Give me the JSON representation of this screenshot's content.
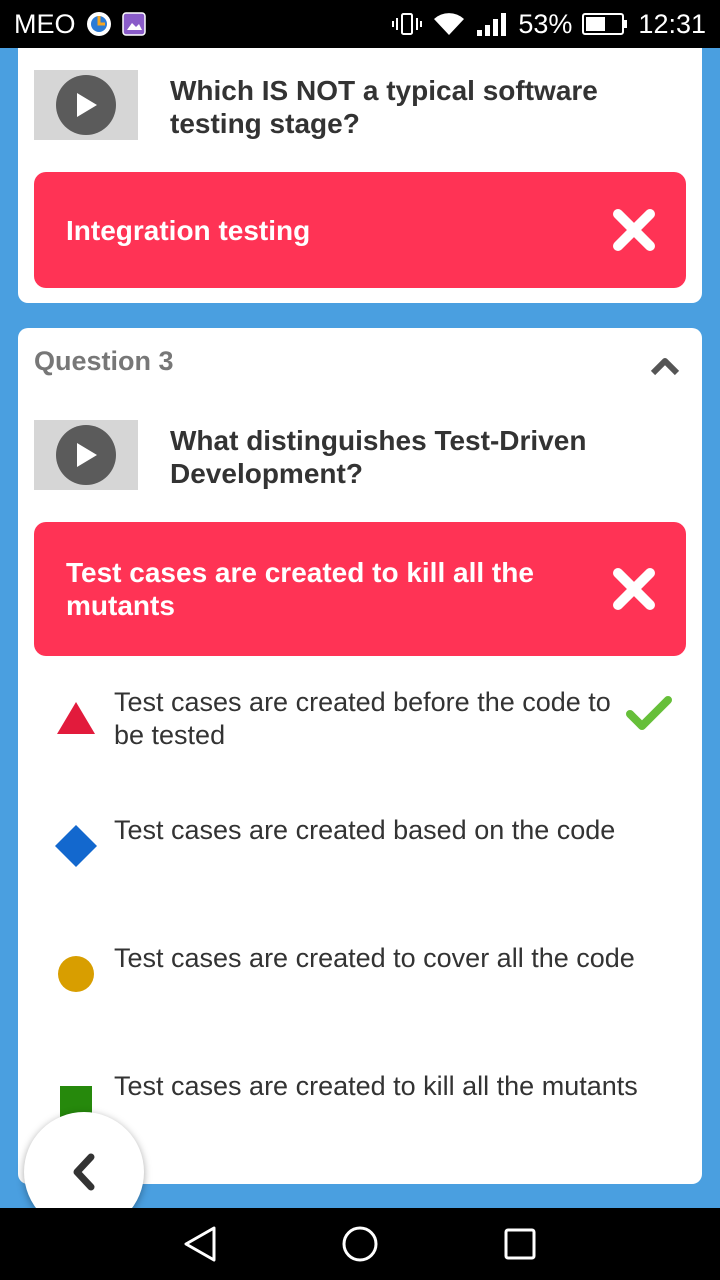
{
  "status_bar": {
    "carrier": "MEO",
    "battery": "53%",
    "time": "12:31"
  },
  "card_previous": {
    "question": "Which IS NOT a typical software testing stage?",
    "selected_answer": "Integration testing",
    "selected_correct": false
  },
  "card_current": {
    "header": "Question 3",
    "question": "What distinguishes Test-Driven Development?",
    "selected_answer": "Test cases are created to kill all the mutants",
    "selected_correct": false,
    "options": [
      {
        "label": "Test cases are created before the code to be tested",
        "shape": "triangle",
        "color": "#e21b3c",
        "correct": true
      },
      {
        "label": "Test cases are created based on the code",
        "shape": "diamond",
        "color": "#1368ce",
        "correct": false
      },
      {
        "label": "Test cases are created to cover all the code",
        "shape": "circle",
        "color": "#d89e00",
        "correct": false
      },
      {
        "label": "Test cases are created to kill all the mutants",
        "shape": "square",
        "color": "#26890c",
        "correct": false
      }
    ]
  },
  "colors": {
    "background": "#4a9fe0",
    "wrong_answer": "#ff3355",
    "check": "#66bf39"
  },
  "icons": {
    "play": "play-icon",
    "wrong": "close-icon",
    "collapse": "chevron-up-icon",
    "correct": "checkmark-icon",
    "back": "chevron-left-icon"
  }
}
